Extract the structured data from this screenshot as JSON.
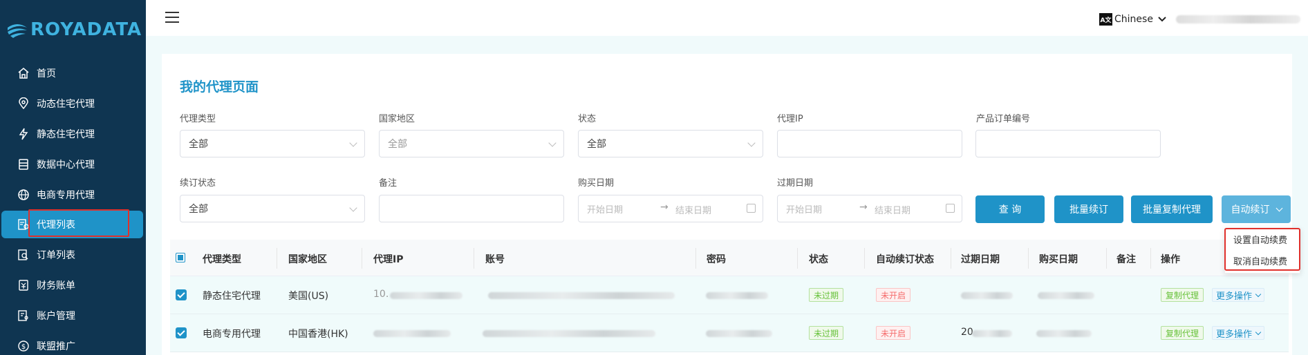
{
  "brand": {
    "logo_text": "ROYADATA",
    "accent": "#1f93c8",
    "sidebar_bg": "#0f3551"
  },
  "sidebar": {
    "items": [
      {
        "label": "首页",
        "icon": "home-icon"
      },
      {
        "label": "动态住宅代理",
        "icon": "location-pin-icon"
      },
      {
        "label": "静态住宅代理",
        "icon": "lightning-icon"
      },
      {
        "label": "数据中心代理",
        "icon": "database-icon"
      },
      {
        "label": "电商专用代理",
        "icon": "globe-icon"
      },
      {
        "label": "代理列表",
        "icon": "list-icon",
        "active": true
      },
      {
        "label": "订单列表",
        "icon": "search-document-icon"
      },
      {
        "label": "财务账单",
        "icon": "wallet-icon"
      },
      {
        "label": "账户管理",
        "icon": "user-document-icon"
      },
      {
        "label": "联盟推广",
        "icon": "dollar-icon"
      }
    ]
  },
  "topbar": {
    "language": "Chinese",
    "language_icon": "translate-icon"
  },
  "page": {
    "title": "我的代理页面"
  },
  "filters": {
    "proxy_type": {
      "label": "代理类型",
      "value": "全部"
    },
    "country": {
      "label": "国家地区",
      "placeholder": "全部"
    },
    "status": {
      "label": "状态",
      "value": "全部"
    },
    "proxy_ip": {
      "label": "代理IP",
      "value": ""
    },
    "order_no": {
      "label": "产品订单编号",
      "value": ""
    },
    "renew_status": {
      "label": "续订状态",
      "value": "全部"
    },
    "remark": {
      "label": "备注",
      "value": ""
    },
    "purchase_date": {
      "label": "购买日期",
      "start": "开始日期",
      "end": "结束日期"
    },
    "expire_date": {
      "label": "过期日期",
      "start": "开始日期",
      "end": "结束日期"
    }
  },
  "buttons": {
    "query": "查 询",
    "batch_renew": "批量续订",
    "batch_copy": "批量复制代理",
    "auto_renew": "自动续订"
  },
  "auto_renew_menu": {
    "set": "设置自动续费",
    "cancel": "取消自动续费"
  },
  "table": {
    "headers": [
      "代理类型",
      "国家地区",
      "代理IP",
      "账号",
      "密码",
      "状态",
      "自动续订状态",
      "过期日期",
      "购买日期",
      "备注",
      "操作"
    ],
    "rows": [
      {
        "type": "静态住宅代理",
        "country": "美国(US)",
        "ip_prefix": "10.",
        "status": "未过期",
        "auto_renew": "未开启",
        "copy": "复制代理",
        "more": "更多操作"
      },
      {
        "type": "电商专用代理",
        "country": "中国香港(HK)",
        "expire_prefix": "20",
        "status": "未过期",
        "auto_renew": "未开启",
        "copy": "复制代理",
        "more": "更多操作"
      }
    ]
  }
}
